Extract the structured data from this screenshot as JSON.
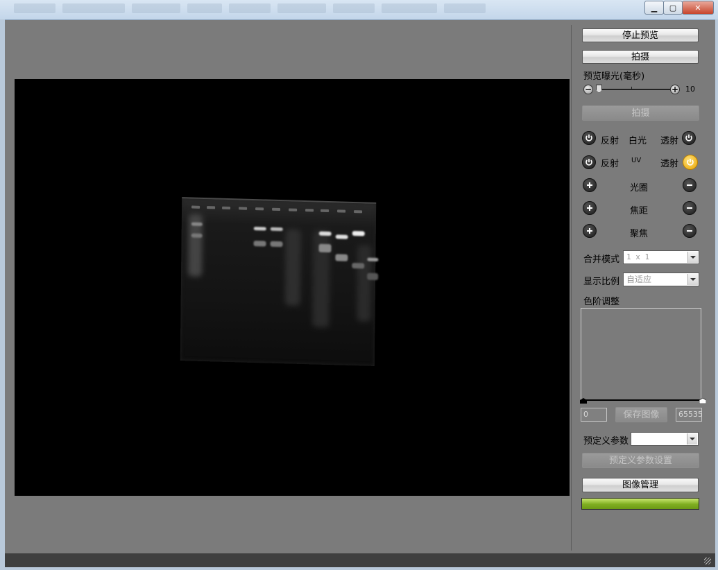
{
  "window": {
    "minimize_glyph": "▁",
    "maximize_glyph": "▢",
    "close_glyph": "✕"
  },
  "preview_panel": {
    "stop_preview_label": "停止预览",
    "capture_label": "拍摄",
    "exposure_label": "预览曝光(毫秒)",
    "exposure_value": "10",
    "exposure_fraction": 0.0,
    "capture2_label": "拍摄"
  },
  "lights": {
    "white_row": {
      "left_label": "反射",
      "center_label": "白光",
      "right_label": "透射",
      "left_on": false,
      "right_on": false
    },
    "uv_row": {
      "left_label": "反射",
      "center_label": "UV",
      "right_label": "透射",
      "left_on": false,
      "right_on": true
    }
  },
  "optics": [
    {
      "label": "光圈"
    },
    {
      "label": "焦距"
    },
    {
      "label": "聚焦"
    }
  ],
  "merge_mode": {
    "label": "合并模式",
    "value": "1 x 1"
  },
  "display_scale": {
    "label": "显示比例",
    "value": "自适应"
  },
  "levels": {
    "label": "色阶调整",
    "min_value": "0",
    "max_value": "65535",
    "save_label": "保存图像"
  },
  "preset": {
    "label": "预定义参数",
    "value": "",
    "settings_label": "预定义参数设置"
  },
  "image_manage_label": "图像管理",
  "progress_fraction": 1.0,
  "colors": {
    "background": "#7b7b7b",
    "preview": "#000000",
    "progress": "#8dbb2a",
    "toggle_on": "#f2b817"
  }
}
